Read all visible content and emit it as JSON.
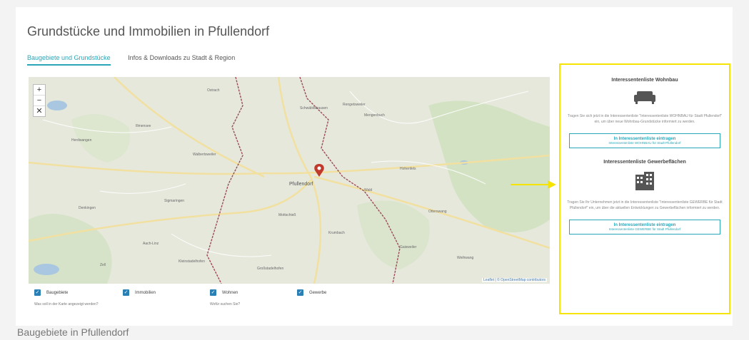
{
  "page": {
    "title": "Grundstücke und Immobilien in Pfullendorf",
    "tabs": [
      {
        "label": "Baugebiete und Grundstücke"
      },
      {
        "label": "Infos & Downloads zu Stadt & Region"
      }
    ]
  },
  "map": {
    "zoom_in": "+",
    "zoom_out": "−",
    "fullscreen": "✕",
    "marker_label": "Pfullendorf",
    "attribution": "Leaflet | © OpenStreetMap contributors",
    "towns": [
      "Ostrach",
      "Herdwangen",
      "Illmensee",
      "Wald",
      "Sigmaringen",
      "Denkingen",
      "Aach-Linz",
      "Mottschieß",
      "Otterswang",
      "Weihwang",
      "Zell",
      "Kleinstadelhofen",
      "Großstadelhofen",
      "Krumbach",
      "Hohenfels",
      "Walbertsweiler",
      "Gaisweiler",
      "Rengetsweiler",
      "Schwäblishausen",
      "Mengenbuch"
    ]
  },
  "filters": [
    {
      "label": "Baugebiete",
      "hint": "Was soll in der Karte angezeigt werden?"
    },
    {
      "label": "Immobilien",
      "hint": ""
    },
    {
      "label": "Wohnen",
      "hint": "Wofür suchen Sie?"
    },
    {
      "label": "Gewerbe",
      "hint": ""
    }
  ],
  "side_panel": {
    "housing": {
      "title": "Interessentenliste Wohnbau",
      "icon": "sofa-icon",
      "text": "Tragen Sie sich jetzt in die Interessentenliste \"Interessentenliste WOHNBAU für Stadt Pfullendorf\" ein, um über neue Wohnbau-Grundstücke informiert zu werden.",
      "button_line1": "In Interessentenliste eintragen",
      "button_line2": "Interessentenliste WOHNBAU für Stadt Pfullendorf"
    },
    "commercial": {
      "title": "Interessentenliste Gewerbeflächen",
      "icon": "buildings-icon",
      "text": "Tragen Sie Ihr Unternehmen jetzt in die Interessentenliste \"Interessentenliste GEWERBE für Stadt Pfullendorf\" ein, um über die aktuellen Entwicklungen zu Gewerbeflächen informiert zu werden.",
      "button_line1": "In Interessentenliste eintragen",
      "button_line2": "Interessentenliste GEWERBE für Stadt Pfullendorf"
    }
  },
  "section": {
    "title": "Baugebiete in Pfullendorf"
  },
  "colors": {
    "accent": "#2aa6b8",
    "highlight": "#f5e400",
    "checkbox": "#2a7fb5",
    "marker": "#c0392b"
  }
}
